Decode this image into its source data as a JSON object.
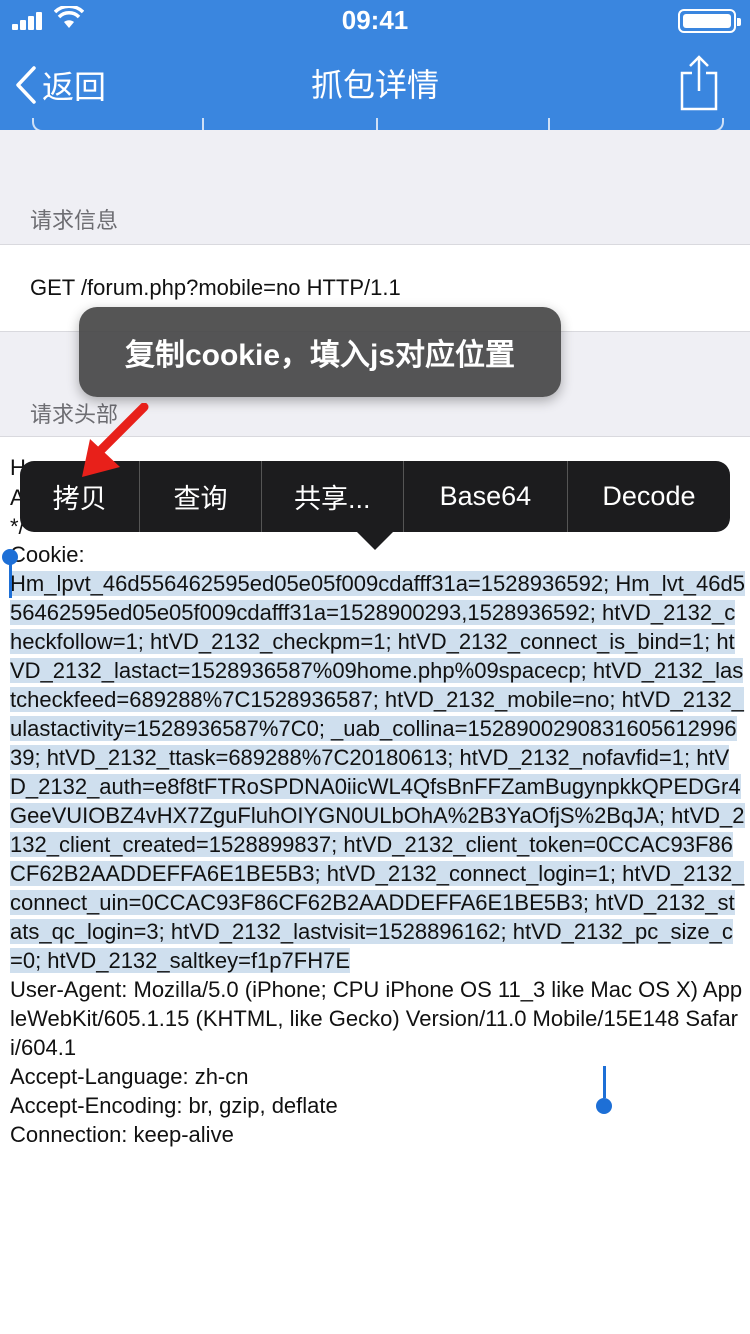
{
  "status": {
    "time": "09:41"
  },
  "nav": {
    "back_label": "返回",
    "title": "抓包详情"
  },
  "sections": {
    "request_info_header": "请求信息",
    "request_line": "GET /forum.php?mobile=no HTTP/1.1",
    "request_headers_header": "请求头部"
  },
  "tooltip": {
    "text": "复制cookie，填入js对应位置"
  },
  "edit_menu": {
    "items": [
      "拷贝",
      "查询",
      "共享...",
      "Base64",
      "Decode"
    ]
  },
  "headers": {
    "partial_line1": "H",
    "partial_line2": "A",
    "partial_line3": "*/",
    "cookie_label": "Cookie:",
    "cookie_value": "Hm_lpvt_46d556462595ed05e05f009cdafff31a=1528936592; Hm_lvt_46d556462595ed05e05f009cdafff31a=1528900293,1528936592; htVD_2132_checkfollow=1; htVD_2132_checkpm=1; htVD_2132_connect_is_bind=1; htVD_2132_lastact=1528936587%09home.php%09spacecp; htVD_2132_lastcheckfeed=689288%7C1528936587; htVD_2132_mobile=no; htVD_2132_ulastactivity=1528936587%7C0; _uab_collina=152890029083160561299639; htVD_2132_ttask=689288%7C20180613; htVD_2132_nofavfid=1; htVD_2132_auth=e8f8tFTRoSPDNA0iicWL4QfsBnFFZamBugynpkkQPEDGr4GeeVUIOBZ4vHX7ZguFluhOIYGN0ULbOhA%2B3YaOfjS%2BqJA; htVD_2132_client_created=1528899837; htVD_2132_client_token=0CCAC93F86CF62B2AADDEFFA6E1BE5B3; htVD_2132_connect_login=1; htVD_2132_connect_uin=0CCAC93F86CF62B2AADDEFFA6E1BE5B3; htVD_2132_stats_qc_login=3; htVD_2132_lastvisit=1528896162; htVD_2132_pc_size_c=0; htVD_2132_saltkey=f1p7FH7E",
    "user_agent": "User-Agent: Mozilla/5.0 (iPhone; CPU iPhone OS 11_3 like Mac OS X) AppleWebKit/605.1.15 (KHTML, like Gecko) Version/11.0 Mobile/15E148 Safari/604.1",
    "accept_language": "Accept-Language: zh-cn",
    "accept_encoding": "Accept-Encoding: br, gzip, deflate",
    "connection": "Connection: keep-alive"
  },
  "colors": {
    "nav_blue": "#3a86df",
    "selection": "#cfdfee",
    "handle": "#1d6fd6",
    "arrow_red": "#e8201a"
  }
}
